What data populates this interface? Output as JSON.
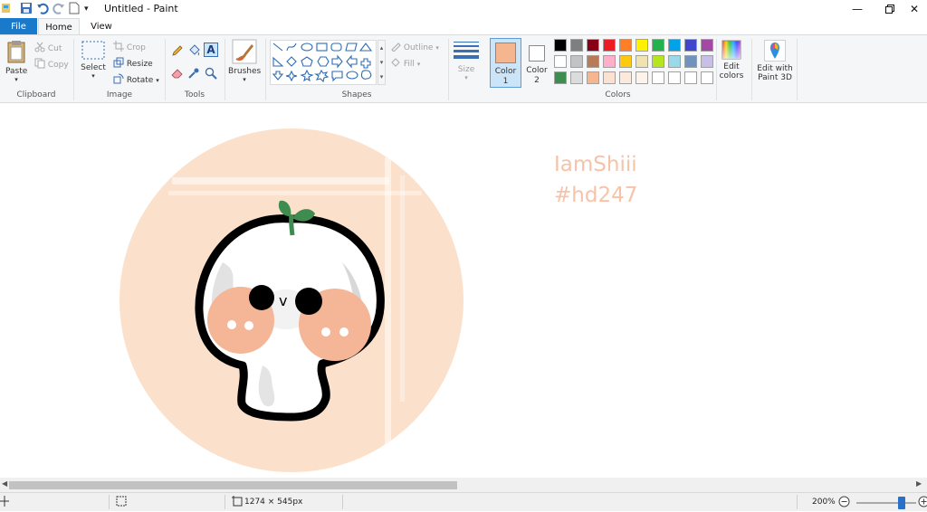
{
  "window": {
    "title": "Untitled - Paint",
    "quick_access": [
      "save-icon",
      "undo-icon",
      "redo-icon",
      "new-document-icon",
      "customize-dropdown-icon"
    ],
    "controls": [
      "minimize-icon",
      "restore-icon",
      "close-icon"
    ]
  },
  "tabs": [
    {
      "label": "File",
      "active": false
    },
    {
      "label": "Home",
      "active": true
    },
    {
      "label": "View",
      "active": false
    }
  ],
  "ribbon": {
    "clipboard": {
      "label": "Clipboard",
      "paste": "Paste",
      "cut": "Cut",
      "copy": "Copy"
    },
    "image": {
      "label": "Image",
      "select": "Select",
      "crop": "Crop",
      "resize": "Resize",
      "rotate": "Rotate"
    },
    "tools": {
      "label": "Tools",
      "items": [
        "pencil-icon",
        "fill-bucket-icon",
        "text-icon",
        "eraser-icon",
        "color-picker-icon",
        "magnifier-icon"
      ]
    },
    "brushes": {
      "label": "Brushes"
    },
    "shapes": {
      "label": "Shapes",
      "outline": "Outline",
      "fill": "Fill"
    },
    "size": {
      "label": "Size"
    },
    "color1": {
      "label": "Color",
      "num": "1",
      "value": "#f5b58f"
    },
    "color2": {
      "label": "Color",
      "num": "2",
      "value": "#ffffff"
    },
    "colors": {
      "label": "Colors",
      "row1": [
        "#000000",
        "#7f7f7f",
        "#880015",
        "#ed1c24",
        "#ff7f27",
        "#fff200",
        "#22b14c",
        "#00a2e8",
        "#3f48cc",
        "#a349a4"
      ],
      "row2": [
        "#ffffff",
        "#c3c3c3",
        "#b97a57",
        "#ffaec9",
        "#ffc90e",
        "#efe4b0",
        "#b5e61d",
        "#99d9ea",
        "#7092be",
        "#c8bfe7"
      ],
      "row3": [
        "#3e8c4f",
        "#dcdcdc",
        "#f5b58f",
        "#fbe1cf",
        "#fbe9dc",
        "#fdf3ea",
        "#ffffff",
        "#ffffff",
        "#ffffff",
        "#ffffff"
      ]
    },
    "edit_colors": {
      "line1": "Edit",
      "line2": "colors"
    },
    "paint3d": {
      "line1": "Edit with",
      "line2": "Paint 3D"
    }
  },
  "canvas": {
    "watermark_name": "IamShiii",
    "watermark_tag": "#hd247",
    "accent_peach": "#fbe1cb",
    "blush_color": "#f5b597",
    "sprout_color": "#3e8c4f",
    "face_letter": "v"
  },
  "status": {
    "dimensions": "1274 × 545px",
    "zoom": "200%",
    "zoom_level_fraction": 0.8
  }
}
